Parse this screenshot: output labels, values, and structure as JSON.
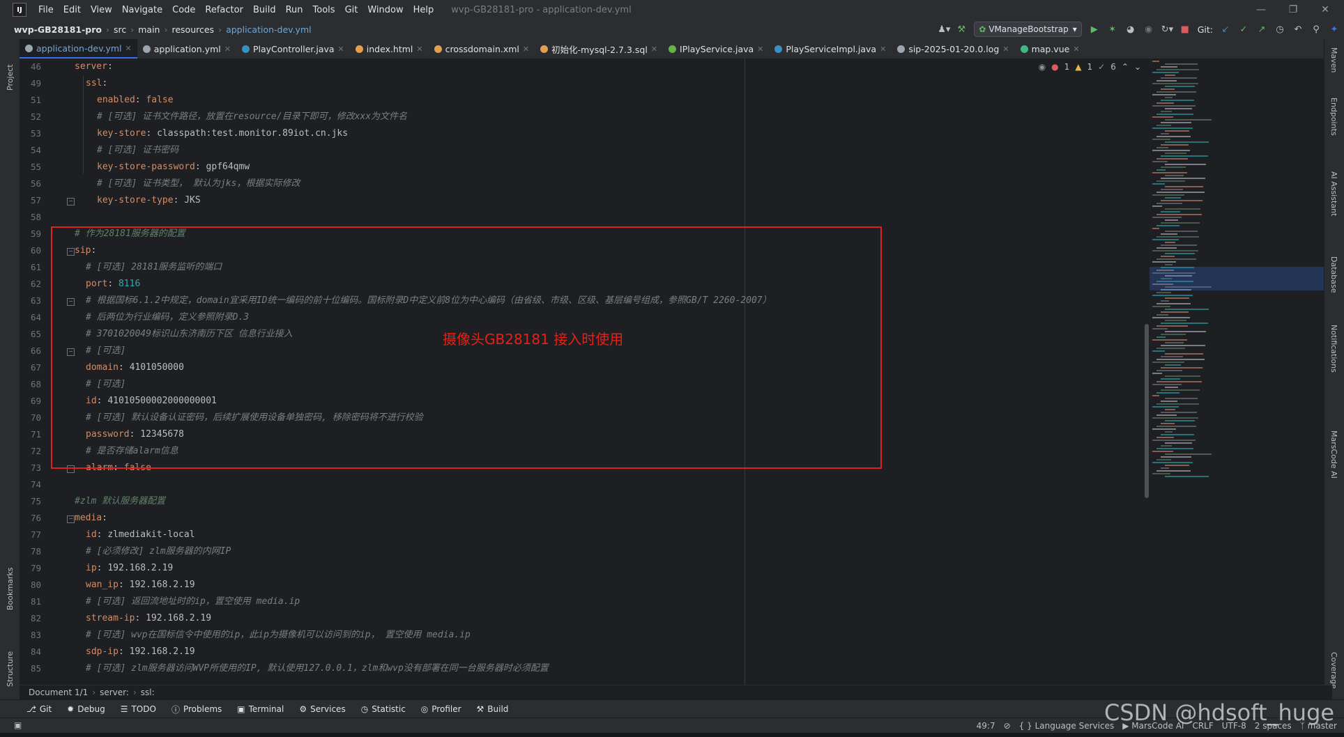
{
  "app": {
    "title": "wvp-GB28181-pro - application-dev.yml",
    "menu": [
      "File",
      "Edit",
      "View",
      "Navigate",
      "Code",
      "Refactor",
      "Build",
      "Run",
      "Tools",
      "Git",
      "Window",
      "Help"
    ]
  },
  "toolbar": {
    "breadcrumb": [
      "wvp-GB28181-pro",
      "src",
      "main",
      "resources",
      "application-dev.yml"
    ],
    "run_config": "VManageBootstrap",
    "git_label": "Git:"
  },
  "tabs": [
    {
      "label": "application-dev.yml",
      "color": "#9aa7b0",
      "active": true
    },
    {
      "label": "application.yml",
      "color": "#9aa7b0",
      "active": false
    },
    {
      "label": "PlayController.java",
      "color": "#3592c4",
      "active": false
    },
    {
      "label": "index.html",
      "color": "#e3a04c",
      "active": false
    },
    {
      "label": "crossdomain.xml",
      "color": "#e3a04c",
      "active": false
    },
    {
      "label": "初始化-mysql-2.7.3.sql",
      "color": "#e3a04c",
      "active": false
    },
    {
      "label": "IPlayService.java",
      "color": "#62b543",
      "active": false
    },
    {
      "label": "PlayServiceImpl.java",
      "color": "#3592c4",
      "active": false
    },
    {
      "label": "sip-2025-01-20.0.log",
      "color": "#9aa7b0",
      "active": false
    },
    {
      "label": "map.vue",
      "color": "#41b883",
      "active": false
    }
  ],
  "left_strip": {
    "project": "Project",
    "bookmarks": "Bookmarks",
    "structure": "Structure"
  },
  "right_strip": {
    "maven": "Maven",
    "endpoints": "Endpoints",
    "ai": "AI Assistant",
    "database": "Database",
    "notifications": "Notifications",
    "marscode": "MarsCode AI",
    "coverage": "Coverage"
  },
  "inspections": {
    "errors": "1",
    "warnings": "1",
    "ok": "6"
  },
  "editor": {
    "lines": [
      {
        "n": "46",
        "indent": 0,
        "key": "server",
        "val": "",
        "comment": ""
      },
      {
        "n": "49",
        "indent": 1,
        "key": "ssl",
        "val": "",
        "comment": ""
      },
      {
        "n": "51",
        "indent": 2,
        "key": "enabled",
        "val": "false",
        "comment": ""
      },
      {
        "n": "52",
        "indent": 2,
        "key": "",
        "val": "",
        "comment": "# [可选] 证书文件路径，放置在resource/目录下即可，修改xxx为文件名"
      },
      {
        "n": "53",
        "indent": 2,
        "key": "key-store",
        "val": "classpath:test.monitor.89iot.cn.jks",
        "comment": ""
      },
      {
        "n": "54",
        "indent": 2,
        "key": "",
        "val": "",
        "comment": "# [可选] 证书密码"
      },
      {
        "n": "55",
        "indent": 2,
        "key": "key-store-password",
        "val": "gpf64qmw",
        "comment": ""
      },
      {
        "n": "56",
        "indent": 2,
        "key": "",
        "val": "",
        "comment": "# [可选] 证书类型， 默认为jks，根据实际修改"
      },
      {
        "n": "57",
        "indent": 2,
        "key": "key-store-type",
        "val": "JKS",
        "comment": ""
      },
      {
        "n": "58",
        "indent": 0,
        "key": "",
        "val": "",
        "comment": ""
      },
      {
        "n": "59",
        "indent": 0,
        "key": "",
        "val": "",
        "comment": "# 作为28181服务器的配置"
      },
      {
        "n": "60",
        "indent": 0,
        "key": "sip",
        "val": "",
        "comment": ""
      },
      {
        "n": "61",
        "indent": 1,
        "key": "",
        "val": "",
        "comment": "# [可选] 28181服务监听的端口"
      },
      {
        "n": "62",
        "indent": 1,
        "key": "port",
        "val": "8116",
        "comment": "",
        "num": true
      },
      {
        "n": "63",
        "indent": 1,
        "key": "",
        "val": "",
        "comment": "# 根据国标6.1.2中规定，domain宜采用ID统一编码的前十位编码。国标附录D中定义前8位为中心编码（由省级、市级、区级、基层编号组成，参照GB/T 2260-2007）"
      },
      {
        "n": "64",
        "indent": 1,
        "key": "",
        "val": "",
        "comment": "# 后两位为行业编码，定义参照附录D.3"
      },
      {
        "n": "65",
        "indent": 1,
        "key": "",
        "val": "",
        "comment": "# 3701020049标识山东济南历下区 信息行业接入"
      },
      {
        "n": "66",
        "indent": 1,
        "key": "",
        "val": "",
        "comment": "# [可选]"
      },
      {
        "n": "67",
        "indent": 1,
        "key": "domain",
        "val": "4101050000",
        "comment": ""
      },
      {
        "n": "68",
        "indent": 1,
        "key": "",
        "val": "",
        "comment": "# [可选]"
      },
      {
        "n": "69",
        "indent": 1,
        "key": "id",
        "val": "41010500002000000001",
        "comment": ""
      },
      {
        "n": "70",
        "indent": 1,
        "key": "",
        "val": "",
        "comment": "# [可选] 默认设备认证密码，后续扩展使用设备单独密码, 移除密码将不进行校验"
      },
      {
        "n": "71",
        "indent": 1,
        "key": "password",
        "val": "12345678",
        "comment": ""
      },
      {
        "n": "72",
        "indent": 1,
        "key": "",
        "val": "",
        "comment": "# 是否存储alarm信息"
      },
      {
        "n": "73",
        "indent": 1,
        "key": "alarm",
        "val": "false",
        "comment": ""
      },
      {
        "n": "74",
        "indent": 0,
        "key": "",
        "val": "",
        "comment": ""
      },
      {
        "n": "75",
        "indent": 0,
        "key": "",
        "val": "",
        "comment": "#zlm 默认服务器配置"
      },
      {
        "n": "76",
        "indent": 0,
        "key": "media",
        "val": "",
        "comment": ""
      },
      {
        "n": "77",
        "indent": 1,
        "key": "id",
        "val": "zlmediakit-local",
        "comment": ""
      },
      {
        "n": "78",
        "indent": 1,
        "key": "",
        "val": "",
        "comment": "# [必须修改] zlm服务器的内网IP"
      },
      {
        "n": "79",
        "indent": 1,
        "key": "ip",
        "val": "192.168.2.19",
        "comment": ""
      },
      {
        "n": "80",
        "indent": 1,
        "key": "wan_ip",
        "val": "192.168.2.19",
        "comment": ""
      },
      {
        "n": "81",
        "indent": 1,
        "key": "",
        "val": "",
        "comment": "# [可选] 返回流地址时的ip，置空使用 media.ip"
      },
      {
        "n": "82",
        "indent": 1,
        "key": "stream-ip",
        "val": "192.168.2.19",
        "comment": ""
      },
      {
        "n": "83",
        "indent": 1,
        "key": "",
        "val": "",
        "comment": "# [可选] wvp在国标信令中使用的ip，此ip为摄像机可以访问到的ip， 置空使用 media.ip"
      },
      {
        "n": "84",
        "indent": 1,
        "key": "sdp-ip",
        "val": "192.168.2.19",
        "comment": ""
      },
      {
        "n": "85",
        "indent": 1,
        "key": "",
        "val": "",
        "comment": "# [可选] zlm服务器访问WVP所使用的IP, 默认使用127.0.0.1，zlm和wvp没有部署在同一台服务器时必须配置"
      }
    ],
    "annotation": "摄像头GB28181 接入时使用"
  },
  "editor_breadcrumb": [
    "Document 1/1",
    "server:",
    "ssl:"
  ],
  "bottom_tools": [
    "Git",
    "Debug",
    "TODO",
    "Problems",
    "Terminal",
    "Services",
    "Statistic",
    "Profiler",
    "Build"
  ],
  "status": {
    "position": "49:7",
    "lang": "Language Services",
    "marscode": "MarsCode AI",
    "line_sep": "CRLF",
    "encoding": "UTF-8",
    "indent": "2 spaces",
    "branch": "master"
  },
  "watermark": "CSDN @hdsoft_huge"
}
